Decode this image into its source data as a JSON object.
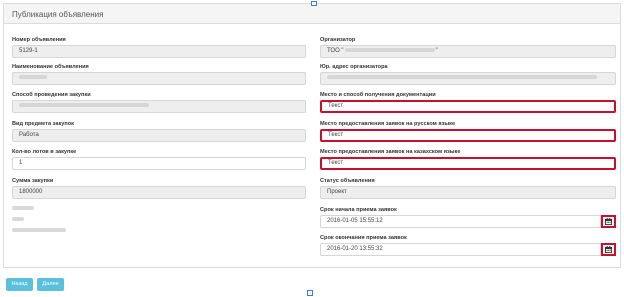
{
  "panel": {
    "title": "Публикация объявления"
  },
  "left": {
    "number": {
      "label": "Номер объявления",
      "value": "5129-1"
    },
    "name": {
      "label": "Наименование объявления",
      "value": ""
    },
    "method": {
      "label": "Способ проведения закупки",
      "value": ""
    },
    "subject_type": {
      "label": "Вид предмета закупок",
      "value": "Работа"
    },
    "lots_count": {
      "label": "Кол-во лотов в закупке",
      "value": "1"
    },
    "amount": {
      "label": "Сумма закупки",
      "value": "1800000"
    }
  },
  "right": {
    "organizer": {
      "label": "Организатор",
      "value": "ТОО \"",
      "value_end": "\""
    },
    "organizer_address": {
      "label": "Юр. адрес организатора",
      "value": ""
    },
    "docs_place": {
      "label": "Место и способ получения документации",
      "value": "Текст"
    },
    "place_ru": {
      "label": "Место предоставления заявок на русском языке",
      "value": "Текст"
    },
    "place_kz": {
      "label": "Место предоставления заявок на казахском языке",
      "value": "Текст"
    },
    "status": {
      "label": "Статус объявления",
      "value": "Проект"
    },
    "start_date": {
      "label": "Срок начала приема заявок",
      "value": "2016-01-05 15:55:12",
      "icon": "calendar-icon"
    },
    "end_date": {
      "label": "Срок окончания приема заявок",
      "value": "2016-01-20 13:55:32",
      "icon": "calendar-icon"
    }
  },
  "buttons": {
    "back": "Назад",
    "next": "Далее"
  },
  "colors": {
    "highlight": "#c8102e",
    "button": "#5bc0de",
    "readonly_bg": "#eeeeee"
  }
}
